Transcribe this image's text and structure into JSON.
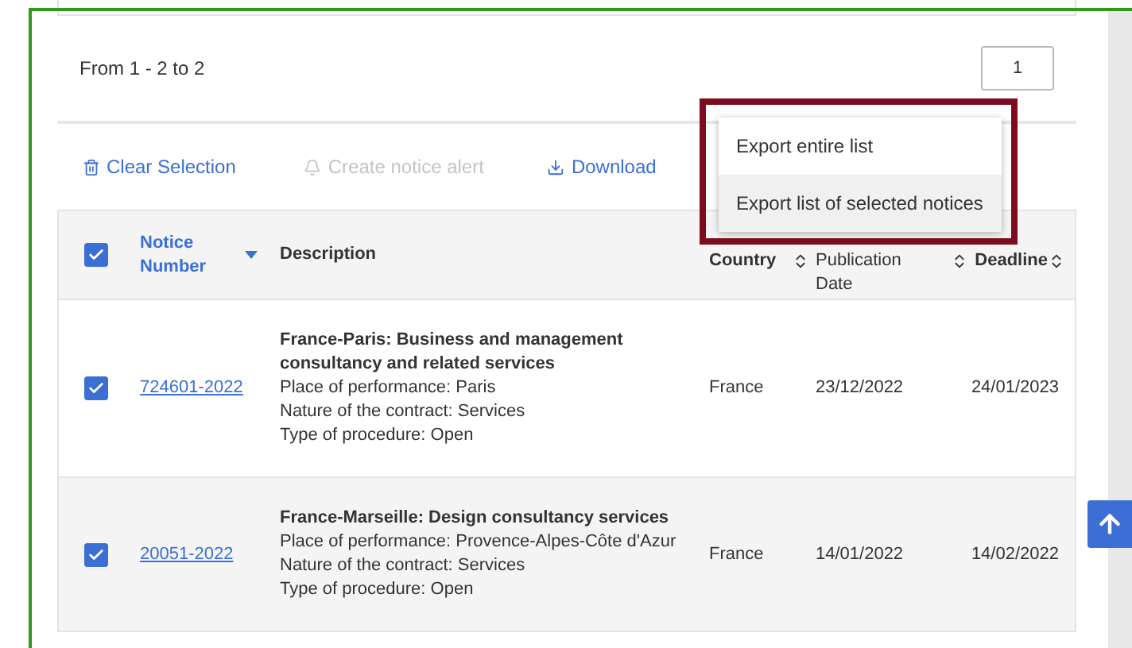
{
  "pagination": {
    "summary": "From 1 - 2 to 2",
    "page": "1"
  },
  "actions": [
    {
      "label": "Clear Selection",
      "disabled": false
    },
    {
      "label": "Create notice alert",
      "disabled": true
    },
    {
      "label": "Download",
      "disabled": false
    }
  ],
  "export_menu": {
    "items": [
      {
        "label": "Export entire list",
        "highlighted": false
      },
      {
        "label": "Export list of selected notices",
        "highlighted": true
      }
    ]
  },
  "table": {
    "select_all": {
      "checked": true
    },
    "columns": [
      {
        "label": "Notice Number",
        "sort_active": true
      },
      {
        "label": "Description"
      },
      {
        "label": "Country",
        "sort_active": false
      },
      {
        "label": "Publication Date",
        "sort_active": false
      },
      {
        "label": "Deadline",
        "sort_active": false
      }
    ],
    "rows": [
      {
        "checked": true,
        "notice_number": "724601-2022",
        "title": "France-Paris: Business and management consultancy and related services",
        "lines": [
          "Place of performance: Paris",
          "Nature of the contract: Services",
          "Type of procedure: Open"
        ],
        "country": "France",
        "publication_date": "23/12/2022",
        "deadline": "24/01/2023"
      },
      {
        "checked": true,
        "notice_number": "20051-2022",
        "title": "France-Marseille: Design consultancy services",
        "lines": [
          "Place of performance: Provence-Alpes-Côte d'Azur",
          "Nature of the contract: Services",
          "Type of procedure: Open"
        ],
        "country": "France",
        "publication_date": "14/01/2022",
        "deadline": "14/02/2022"
      }
    ]
  }
}
